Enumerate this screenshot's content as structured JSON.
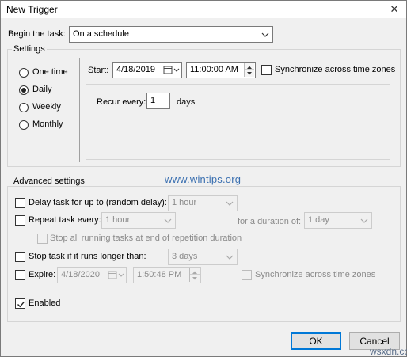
{
  "window": {
    "title": "New Trigger",
    "close_glyph": "✕"
  },
  "begin": {
    "label": "Begin the task:",
    "value": "On a schedule"
  },
  "settings": {
    "group_label": "Settings",
    "radios": [
      {
        "label": "One time",
        "checked": false
      },
      {
        "label": "Daily",
        "checked": true
      },
      {
        "label": "Weekly",
        "checked": false
      },
      {
        "label": "Monthly",
        "checked": false
      }
    ],
    "start_label": "Start:",
    "start_date": "4/18/2019",
    "start_time": "11:00:00 AM",
    "sync_label": "Synchronize across time zones",
    "recur_label": "Recur every:",
    "recur_value": "1",
    "recur_unit": "days"
  },
  "advanced": {
    "group_label": "Advanced settings",
    "delay_label": "Delay task for up to (random delay):",
    "delay_value": "1 hour",
    "repeat_label": "Repeat task every:",
    "repeat_value": "1 hour",
    "duration_label": "for a duration of:",
    "duration_value": "1 day",
    "stop_running_label": "Stop all running tasks at end of repetition duration",
    "stop_longer_label": "Stop task if it runs longer than:",
    "stop_longer_value": "3 days",
    "expire_label": "Expire:",
    "expire_date": "4/18/2020",
    "expire_time": "1:50:48 PM",
    "expire_sync_label": "Synchronize across time zones",
    "enabled_label": "Enabled"
  },
  "watermark": "www.wintips.org",
  "buttons": {
    "ok": "OK",
    "cancel": "Cancel"
  },
  "corner_mark": "wsxdn.com"
}
